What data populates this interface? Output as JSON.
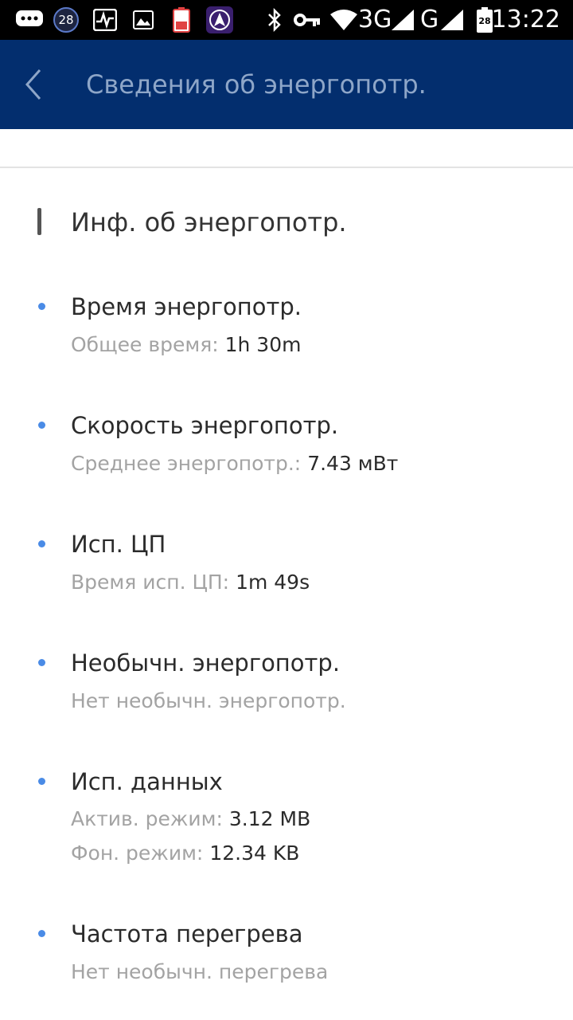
{
  "status_bar": {
    "time": "13:22",
    "network_3g": "3G",
    "network_g": "G",
    "notification_count": "28",
    "battery_level": "28",
    "icons": [
      "chat-icon",
      "badge-28-icon",
      "activity-monitor-icon",
      "gallery-icon",
      "battery-saver-icon",
      "app-a-icon",
      "bluetooth-icon",
      "vpn-key-icon",
      "wifi-icon",
      "signal-icon",
      "signal-icon",
      "sim-icon"
    ]
  },
  "app_bar": {
    "title": "Сведения об энергопотр.",
    "background": "#032e6e",
    "title_color": "#8ea6c8"
  },
  "section": {
    "title": "Инф. об энергопотр."
  },
  "items": [
    {
      "title": "Время энергопотр.",
      "lines": [
        {
          "label": "Общее время: ",
          "value": "1h 30m"
        }
      ]
    },
    {
      "title": "Скорость энергопотр.",
      "lines": [
        {
          "label": "Среднее энергопотр.: ",
          "value": "7.43 мВт"
        }
      ]
    },
    {
      "title": "Исп. ЦП",
      "lines": [
        {
          "label": "Время исп. ЦП: ",
          "value": "1m 49s"
        }
      ]
    },
    {
      "title": "Необычн. энергопотр.",
      "lines": [
        {
          "label": "Нет необычн. энергопотр.",
          "value": ""
        }
      ]
    },
    {
      "title": "Исп. данных",
      "lines": [
        {
          "label": "Актив. режим: ",
          "value": "3.12 MB"
        },
        {
          "label": "Фон. режим: ",
          "value": "12.34 KB"
        }
      ]
    },
    {
      "title": "Частота перегрева",
      "lines": [
        {
          "label": "Нет необычн. перегрева",
          "value": ""
        }
      ]
    }
  ],
  "colors": {
    "bullet": "#4a8be6",
    "label": "#a3a3a3",
    "value": "#2b2b2b"
  }
}
